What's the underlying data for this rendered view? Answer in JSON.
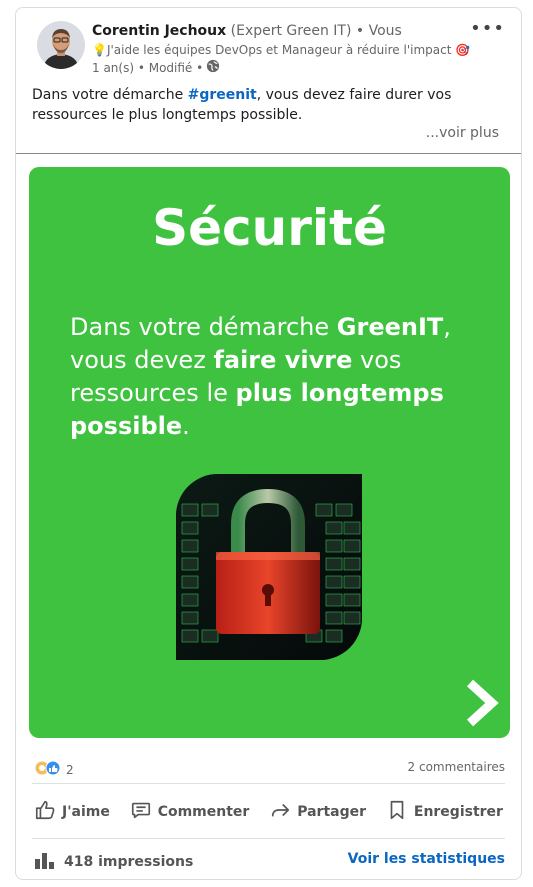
{
  "post": {
    "author_name": "Corentin Jechoux",
    "author_role": " (Expert Green IT)",
    "author_relation": " • Vous",
    "headline": "💡J'aide les équipes DevOps et Manageur à réduire l'impact 🎯 d...",
    "meta_time": "1 an(s) • Modifié •",
    "text_before": "Dans votre démarche ",
    "hashtag": "#greenit",
    "text_after": ", vous devez faire durer vos ressources le plus longtemps possible.",
    "see_more": "...voir plus"
  },
  "slide": {
    "title": "Sécurité",
    "line1_a": "Dans votre démarche ",
    "line1_b": "GreenIT",
    "line1_c": ",",
    "line2_a": "vous devez ",
    "line2_b": "faire vivre",
    "line2_c": " vos",
    "line3_a": "ressources le ",
    "line3_b": "plus longtemps",
    "line4_a": "possible",
    "line4_b": "."
  },
  "social": {
    "reactions_count": "2",
    "comments": "2 commentaires"
  },
  "actions": {
    "like": "J'aime",
    "comment": "Commenter",
    "share": "Partager",
    "save": "Enregistrer"
  },
  "footer": {
    "impressions": "418 impressions",
    "stats_link": "Voir les statistiques"
  },
  "colors": {
    "slide_green": "#3ec23f",
    "link_blue": "#0a66c2"
  }
}
